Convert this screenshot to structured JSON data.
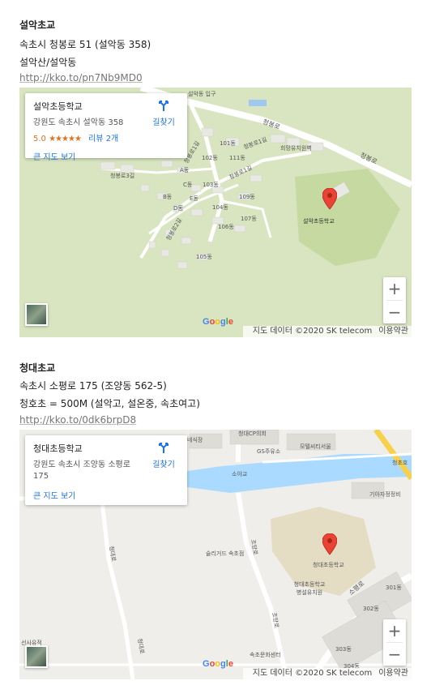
{
  "sections": [
    {
      "title": "설악초교",
      "address": "속초시 청봉로 51 (설악동 358)",
      "extra": "설악산/설악동",
      "link": "http://kko.to/pn7Nb9MD0",
      "map": {
        "card_title": "설악초등학교",
        "card_address": "강원도 속초시 설악동 358",
        "rating": "5.0",
        "stars": "★★★★★",
        "reviews": "리뷰 2개",
        "bigmap": "큰 지도 보기",
        "directions": "길찾기",
        "pin_label": "설악초등학교",
        "labels": {
          "l1": "설악동 입구",
          "l2": "청봉로",
          "l3": "희망유치원벽",
          "l4": "청봉로",
          "l5": "101동",
          "l6": "102동",
          "l7": "111동",
          "l8": "청봉로1길",
          "l9": "A동",
          "l10": "C동",
          "l11": "B동",
          "l12": "E동",
          "l13": "D동",
          "l14": "103동",
          "l15": "109동",
          "l16": "104동",
          "l17": "107동",
          "l18": "106동",
          "l19": "105동",
          "l20": "청봉로3길",
          "l21": "청봉로1길",
          "l22": "청봉로2길",
          "l23": "청봉로1길"
        }
      }
    },
    {
      "title": "청대초교",
      "address": "속초시 소평로 175 (조양동 562-5)",
      "extra": "청호초 = 500M (설악고, 설온중, 속초여고)",
      "link": "http://kko.to/0dk6brpD8",
      "map": {
        "card_title": "청대초등학교",
        "card_address": "강원도 속초시 조양동 소평로 175",
        "bigmap": "큰 지도 보기",
        "directions": "길찾기",
        "pin_label": "청대초등학교",
        "labels": {
          "l1": "청대CP의회",
          "l2": "네식장",
          "l3": "GS주유소",
          "l4": "모텔씨티서울",
          "l5": "소야교",
          "l6": "청초호",
          "l7": "기아자정정비",
          "l8": "슬리거드 속초점",
          "l9": "조양로",
          "l10": "청대초등학교",
          "l11": "청대초등학교 병설유치원",
          "l12": "소평로",
          "l13": "청대로",
          "l14": "301동",
          "l15": "302동",
          "l16": "303동",
          "l17": "304동",
          "l18": "속초문화센터",
          "l19": "조양로",
          "l20": "선사유적",
          "l21": "청대로"
        }
      }
    }
  ],
  "attribution": {
    "data": "지도 데이터 ©2020 SK telecom",
    "terms": "이용약관",
    "google": "Google"
  },
  "colors": {
    "link_blue": "#1a73e8",
    "star_orange": "#e7711b",
    "pin_red": "#ea4335",
    "water": "#aadaff",
    "park": "#c8dca2"
  }
}
